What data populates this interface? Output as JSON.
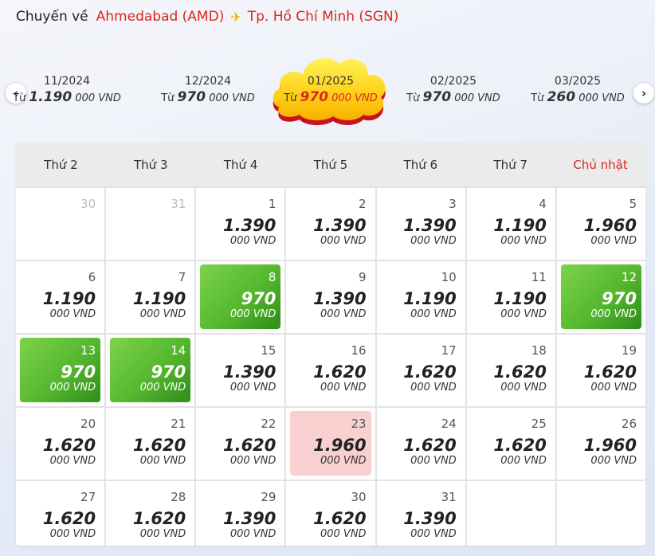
{
  "route": {
    "prefix": "Chuyến về",
    "origin": "Ahmedabad (AMD)",
    "plane_icon": "airplane-icon",
    "destination": "Tp. Hồ Chí Minh (SGN)"
  },
  "months": [
    {
      "name": "11/2024",
      "prefix": "Từ",
      "price": "1.190",
      "unit": "000 VND"
    },
    {
      "name": "12/2024",
      "prefix": "Từ",
      "price": "970",
      "unit": "000 VND"
    },
    {
      "name": "01/2025",
      "prefix": "Từ",
      "price": "970",
      "unit": "000 VND",
      "active": true
    },
    {
      "name": "02/2025",
      "prefix": "Từ",
      "price": "970",
      "unit": "000 VND"
    },
    {
      "name": "03/2025",
      "prefix": "Từ",
      "price": "260",
      "unit": "000 VND"
    }
  ],
  "nav": {
    "prev_icon": "chevron-left-icon",
    "next_icon": "chevron-right-icon"
  },
  "weekdays": [
    "Thứ 2",
    "Thứ 3",
    "Thứ 4",
    "Thứ 5",
    "Thứ 6",
    "Thứ 7",
    "Chủ nhật"
  ],
  "currency_unit": "000 VND",
  "colors": {
    "accent_red": "#d9271c",
    "cheap_green": "#55b82f",
    "selected_pink": "#f8d0d0",
    "plane_yellow": "#f2a900",
    "cloud_yellow": "#ffd21a"
  },
  "days": [
    {
      "day": "30",
      "out": true
    },
    {
      "day": "31",
      "out": true
    },
    {
      "day": "1",
      "price": "1.390"
    },
    {
      "day": "2",
      "price": "1.390"
    },
    {
      "day": "3",
      "price": "1.390"
    },
    {
      "day": "4",
      "price": "1.190"
    },
    {
      "day": "5",
      "price": "1.960"
    },
    {
      "day": "6",
      "price": "1.190"
    },
    {
      "day": "7",
      "price": "1.190"
    },
    {
      "day": "8",
      "price": "970",
      "cheap": true
    },
    {
      "day": "9",
      "price": "1.390"
    },
    {
      "day": "10",
      "price": "1.190"
    },
    {
      "day": "11",
      "price": "1.190"
    },
    {
      "day": "12",
      "price": "970",
      "cheap": true
    },
    {
      "day": "13",
      "price": "970",
      "cheap": true
    },
    {
      "day": "14",
      "price": "970",
      "cheap": true
    },
    {
      "day": "15",
      "price": "1.390"
    },
    {
      "day": "16",
      "price": "1.620"
    },
    {
      "day": "17",
      "price": "1.620"
    },
    {
      "day": "18",
      "price": "1.620"
    },
    {
      "day": "19",
      "price": "1.620"
    },
    {
      "day": "20",
      "price": "1.620"
    },
    {
      "day": "21",
      "price": "1.620"
    },
    {
      "day": "22",
      "price": "1.620"
    },
    {
      "day": "23",
      "price": "1.960",
      "selected": true
    },
    {
      "day": "24",
      "price": "1.620"
    },
    {
      "day": "25",
      "price": "1.620"
    },
    {
      "day": "26",
      "price": "1.960"
    },
    {
      "day": "27",
      "price": "1.620"
    },
    {
      "day": "28",
      "price": "1.620"
    },
    {
      "day": "29",
      "price": "1.390"
    },
    {
      "day": "30",
      "price": "1.620"
    },
    {
      "day": "31",
      "price": "1.390"
    },
    {
      "empty": true
    },
    {
      "empty": true
    }
  ]
}
